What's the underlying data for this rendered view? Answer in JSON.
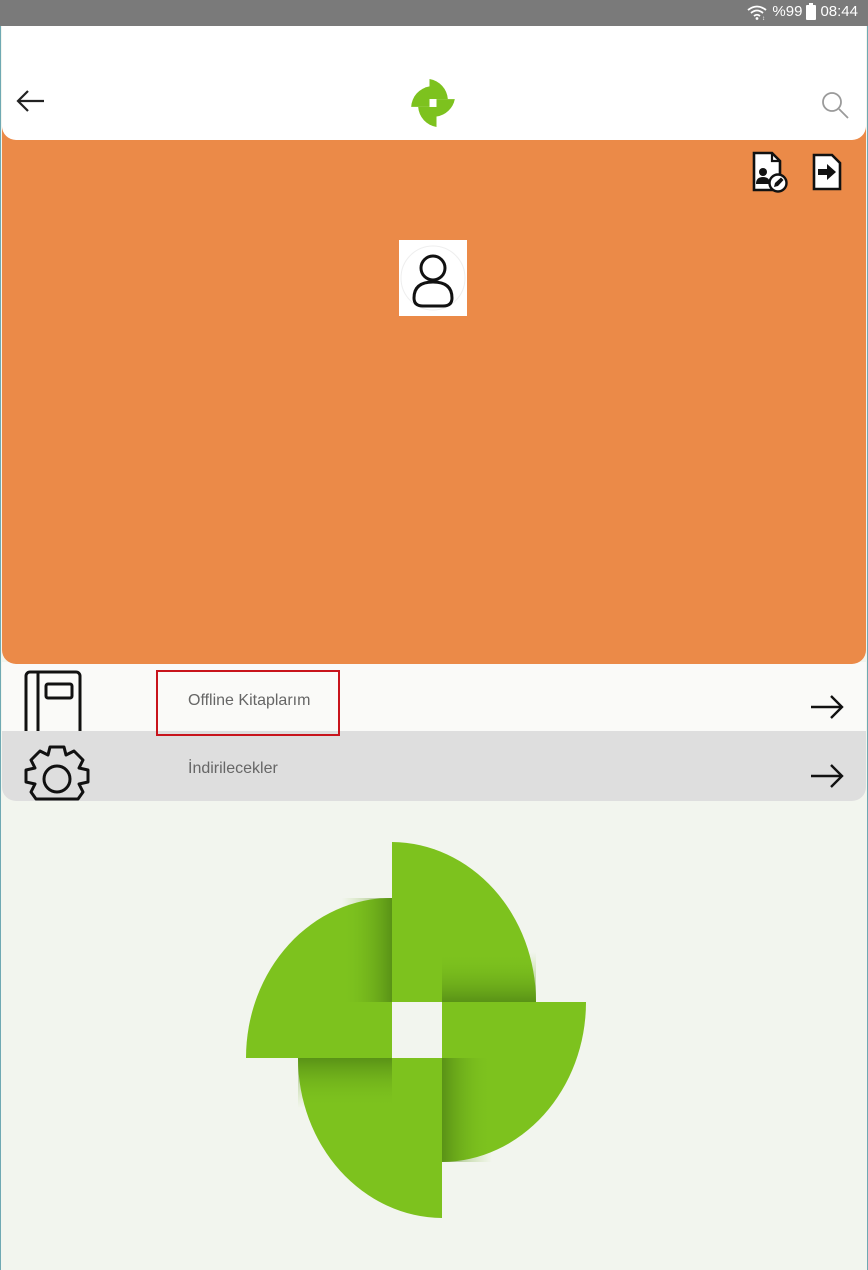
{
  "status_bar": {
    "battery": "%99",
    "time": "08:44",
    "icons": [
      "wifi-icon",
      "battery-icon"
    ]
  },
  "app_bar": {
    "icons": [
      "back-arrow-icon",
      "app-logo-icon",
      "search-icon"
    ]
  },
  "profile": {
    "icons": [
      "edit-profile-icon",
      "logout-icon",
      "avatar-icon"
    ]
  },
  "menu": {
    "items": [
      {
        "label": "Offline Kitaplarım",
        "icon": "notebook-icon",
        "highlighted": true
      },
      {
        "label": "İndirilecekler",
        "icon": "gear-icon",
        "highlighted": false
      }
    ]
  },
  "colors": {
    "status_bar": "#7a7a7a",
    "profile_background": "#eb8a48",
    "brand_green": "#7dc21e",
    "page_background": "#f2f5ee",
    "highlight": "#c8141c"
  }
}
